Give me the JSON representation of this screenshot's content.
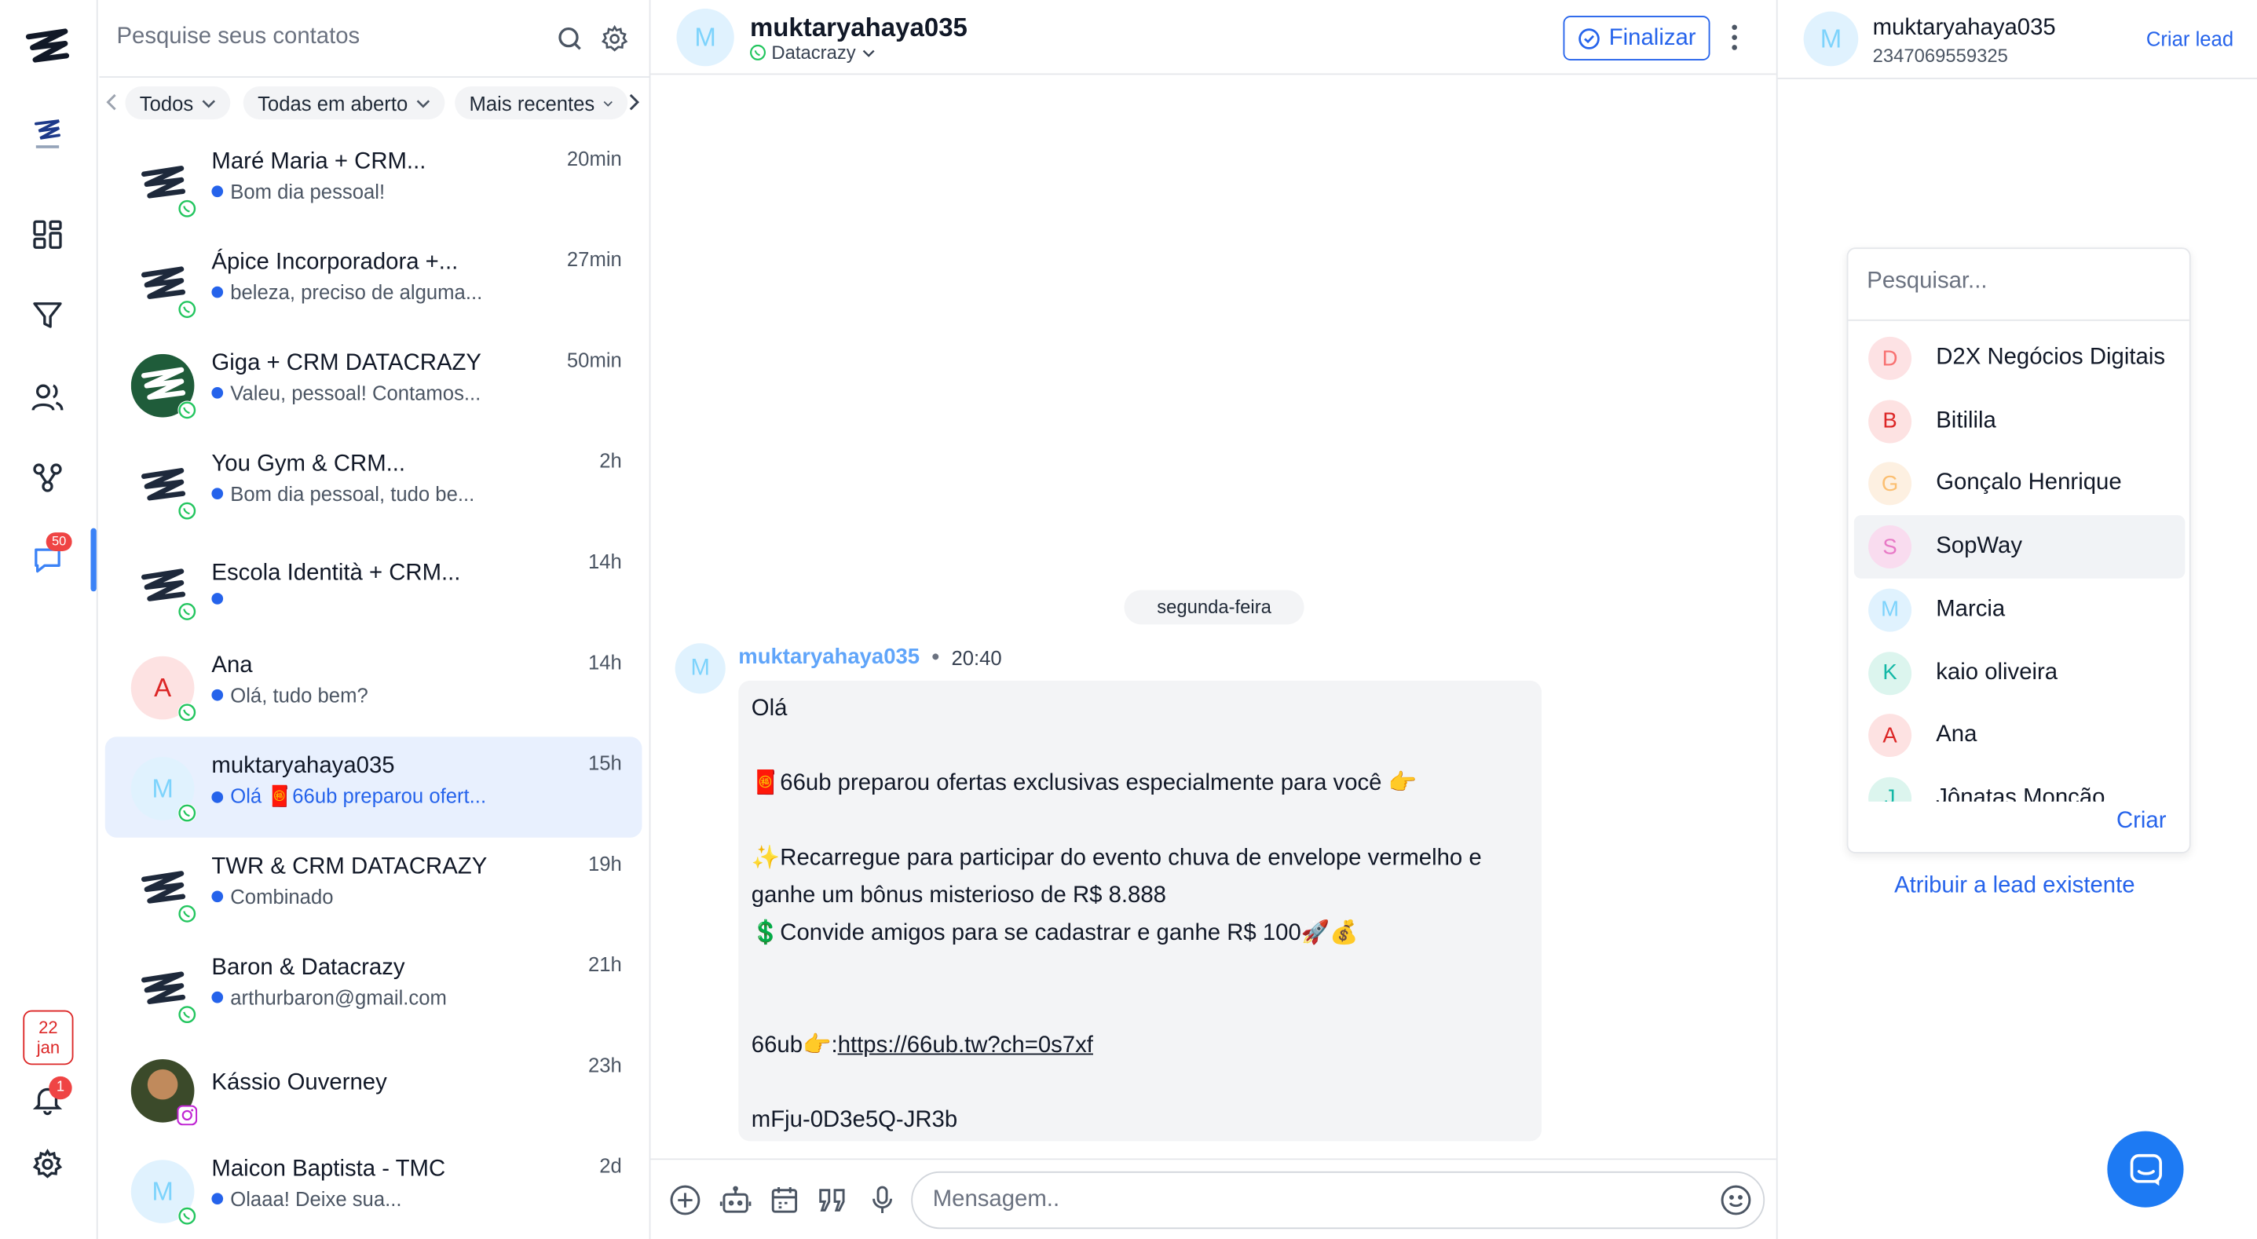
{
  "rail": {
    "chat_badge": "50",
    "date": {
      "day": "22",
      "month": "jan"
    },
    "notification_badge": "1"
  },
  "contacts": {
    "search_placeholder": "Pesquise seus contatos",
    "filters": [
      "Todos",
      "Todas em aberto",
      "Mais recentes"
    ],
    "items": [
      {
        "name": "Maré Maria + CRM...",
        "preview": "Bom dia pessoal!",
        "time": "20min",
        "avatar": "logo",
        "channel": "whatsapp"
      },
      {
        "name": "Ápice Incorporadora +...",
        "preview": "beleza, preciso de alguma...",
        "time": "27min",
        "avatar": "logo",
        "channel": "whatsapp"
      },
      {
        "name": "Giga + CRM DATACRAZY",
        "preview": "Valeu, pessoal! Contamos...",
        "time": "50min",
        "avatar": "logo-dark",
        "channel": "whatsapp"
      },
      {
        "name": "You Gym & CRM...",
        "preview": "Bom dia pessoal, tudo be...",
        "time": "2h",
        "avatar": "logo",
        "channel": "whatsapp"
      },
      {
        "name": "Escola Identità + CRM...",
        "preview": "",
        "time": "14h",
        "avatar": "logo",
        "channel": "whatsapp"
      },
      {
        "name": "Ana",
        "preview": "Olá, tudo bem?",
        "time": "14h",
        "avatar": "A",
        "channel": "whatsapp"
      },
      {
        "name": "muktaryahaya035",
        "preview": "Olá 🧧66ub preparou ofert...",
        "time": "15h",
        "avatar": "M",
        "channel": "whatsapp",
        "selected": true
      },
      {
        "name": "TWR & CRM DATACRAZY",
        "preview": "Combinado",
        "time": "19h",
        "avatar": "logo",
        "channel": "whatsapp"
      },
      {
        "name": "Baron & Datacrazy",
        "preview": "arthurbaron@gmail.com",
        "time": "21h",
        "avatar": "logo",
        "channel": "whatsapp"
      },
      {
        "name": "Kássio Ouverney",
        "preview": "",
        "time": "23h",
        "avatar": "photo",
        "channel": "instagram"
      },
      {
        "name": "Maicon Baptista - TMC",
        "preview": "Olaaa! Deixe sua...",
        "time": "2d",
        "avatar": "M",
        "channel": "whatsapp"
      }
    ]
  },
  "chat": {
    "contact_name": "muktaryahaya035",
    "channel_label": "Datacrazy",
    "finalize_label": "Finalizar",
    "day_separator": "segunda-feira",
    "message": {
      "sender": "muktaryahaya035",
      "time": "20:40",
      "lines": [
        "Olá",
        "",
        "🧧66ub preparou ofertas exclusivas especialmente para você 👉",
        "",
        "✨Recarregue para participar do evento chuva de envelope vermelho e",
        "ganhe um bônus misterioso de R$ 8.888",
        "💲Convide amigos para se cadastrar e ganhe R$ 100🚀💰",
        "",
        "",
        "66ub👉:",
        "",
        "mFju-0D3e5Q-JR3b"
      ],
      "link": "https://66ub.tw?ch=0s7xf"
    },
    "composer_placeholder": "Mensagem.."
  },
  "right_panel": {
    "contact_name": "muktaryahaya035",
    "phone": "2347069559325",
    "create_lead_label": "Criar lead",
    "dropdown": {
      "search_placeholder": "Pesquisar...",
      "items": [
        {
          "initial": "D",
          "name": "D2X Negócios Digitais",
          "bg": "#fde2e4",
          "fg": "#f87171"
        },
        {
          "initial": "B",
          "name": "Bitilila",
          "bg": "#fde2e2",
          "fg": "#dc2626"
        },
        {
          "initial": "G",
          "name": "Gonçalo Henrique",
          "bg": "#fdf0e1",
          "fg": "#fbbf72"
        },
        {
          "initial": "S",
          "name": "SopWay",
          "bg": "#f9dcef",
          "fg": "#e879c6",
          "highlighted": true
        },
        {
          "initial": "M",
          "name": "Marcia",
          "bg": "#e0f2fe",
          "fg": "#7dd3fc"
        },
        {
          "initial": "K",
          "name": "kaio oliveira",
          "bg": "#dcf5ee",
          "fg": "#14b8a6"
        },
        {
          "initial": "A",
          "name": "Ana",
          "bg": "#fde2e2",
          "fg": "#dc2626"
        },
        {
          "initial": "J",
          "name": "Jônatas Monção",
          "bg": "#dcf5ee",
          "fg": "#14b8a6"
        }
      ],
      "create_label": "Criar"
    },
    "assign_label": "Atribuir a lead existente"
  },
  "colors": {
    "accent": "#2563eb",
    "whatsapp": "#22c55e",
    "badge": "#ef4444"
  }
}
